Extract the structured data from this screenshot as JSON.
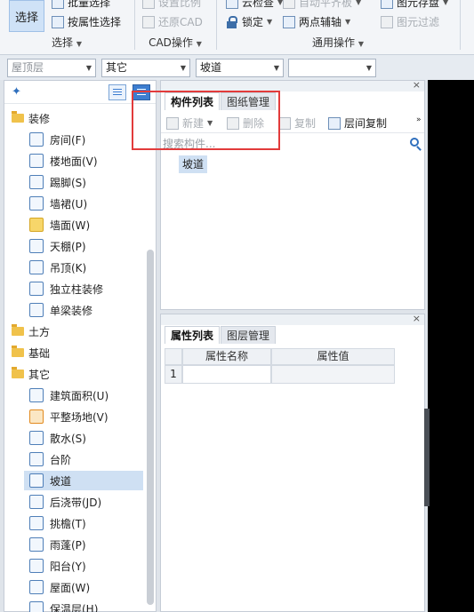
{
  "ribbon": {
    "select_group": {
      "big_button": "选择",
      "items": [
        {
          "label": "批量选择",
          "icon": "batch-select-icon"
        },
        {
          "label": "按属性选择",
          "icon": "select-by-property-icon"
        }
      ],
      "group_label": "选择"
    },
    "cad_group": {
      "items": [
        {
          "label": "设置比例",
          "icon": "set-scale-icon",
          "disabled": true
        },
        {
          "label": "还原CAD",
          "icon": "restore-cad-icon",
          "disabled": true
        }
      ],
      "group_label": "CAD操作"
    },
    "common_group": {
      "items": [
        {
          "label": "云检查",
          "icon": "cloud-check-icon"
        },
        {
          "label": "锁定",
          "icon": "lock-icon"
        },
        {
          "label": "自动平齐板",
          "icon": "auto-align-slab-icon",
          "disabled": true
        },
        {
          "label": "两点辅轴",
          "icon": "two-point-axis-icon"
        },
        {
          "label": "图元存盘",
          "icon": "element-save-icon"
        },
        {
          "label": "图元过滤",
          "icon": "element-filter-icon",
          "disabled": true
        }
      ],
      "group_label": "通用操作"
    }
  },
  "filters": {
    "floor": "屋顶层",
    "category": "其它",
    "component_type": "坡道",
    "component": ""
  },
  "tree": {
    "categories": [
      {
        "label": "装修",
        "children": [
          "房间(F)",
          "楼地面(V)",
          "踢脚(S)",
          "墙裙(U)",
          "墙面(W)",
          "天棚(P)",
          "吊顶(K)",
          "独立柱装修",
          "单梁装修"
        ]
      },
      {
        "label": "土方",
        "children": []
      },
      {
        "label": "基础",
        "children": []
      },
      {
        "label": "其它",
        "children": [
          "建筑面积(U)",
          "平整场地(V)",
          "散水(S)",
          "台阶",
          "坡道",
          "后浇带(JD)",
          "挑檐(T)",
          "雨蓬(P)",
          "阳台(Y)",
          "屋面(W)",
          "保温层(H)"
        ]
      }
    ],
    "selected": "坡道"
  },
  "component_panel": {
    "tabs": [
      "构件列表",
      "图纸管理"
    ],
    "toolbar": {
      "new_label": "新建",
      "delete_label": "删除",
      "copy_label": "复制",
      "floor_copy_label": "层间复制"
    },
    "search_placeholder": "搜索构件...",
    "items": [
      "坡道"
    ]
  },
  "property_panel": {
    "tabs": [
      "属性列表",
      "图层管理"
    ],
    "columns": [
      "属性名称",
      "属性值"
    ],
    "rows": [
      {
        "index": "1",
        "name": "",
        "value": ""
      }
    ]
  },
  "colors": {
    "highlight": "#e23b3b",
    "selection": "#cfe0f3",
    "accent": "#2f6fbd"
  }
}
